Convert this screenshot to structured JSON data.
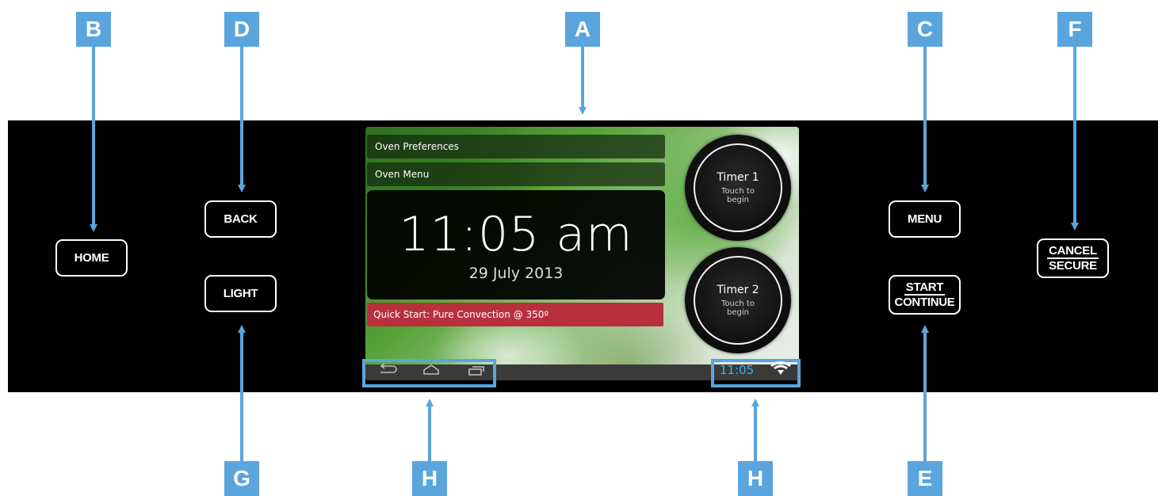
{
  "callouts": {
    "A": "A",
    "B": "B",
    "C": "C",
    "D": "D",
    "E": "E",
    "F": "F",
    "G": "G",
    "H1": "H",
    "H2": "H"
  },
  "buttons": {
    "home": "HOME",
    "back": "BACK",
    "light": "LIGHT",
    "menu": "MENU",
    "start": "START",
    "continue": "CONTINUE",
    "cancel": "CANCEL",
    "secure": "SECURE"
  },
  "screen": {
    "menu_items": [
      "Oven Preferences",
      "Oven Menu"
    ],
    "clock_time": "11:05 am",
    "clock_date": "29 July 2013",
    "quick_start": "Quick Start: Pure Convection @ 350º",
    "timers": [
      {
        "title": "Timer 1",
        "subtitle": "Touch to begin"
      },
      {
        "title": "Timer 2",
        "subtitle": "Touch to begin"
      }
    ],
    "status_time": "11:05",
    "nav_icons": [
      "back-icon",
      "home-icon",
      "recent-apps-icon"
    ],
    "status_icons": [
      "wifi-icon"
    ]
  },
  "colors": {
    "callout": "#5aa5dd",
    "quick_start": "#b8303c",
    "status_time": "#39b6e8",
    "panel": "#000000"
  }
}
